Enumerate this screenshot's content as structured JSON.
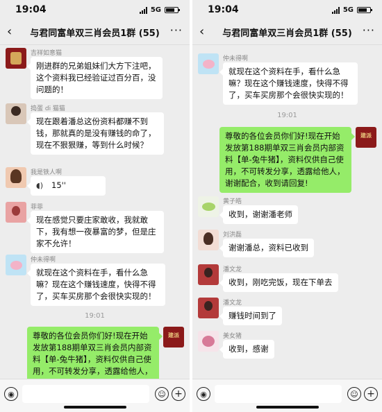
{
  "status": {
    "time": "19:04",
    "network": "5G"
  },
  "chat": {
    "title": "与君同富单双三肖会员1群 (55)"
  },
  "left": {
    "messages": [
      {
        "sender": "吉祥如意猫",
        "text": "刚进群的兄弟姐妹们大方下注吧，这个资料我已经验证过百分百，没问题的！"
      },
      {
        "sender": "捣蛋 di 猫猫",
        "text": "现在跟着潘总这份资料都赚不到钱，那就真的是没有赚钱的命了，现在不狠狠赚，等到什么时候？"
      },
      {
        "sender": "我是铁人啊",
        "voice_duration": "15''"
      },
      {
        "sender": "菲菲",
        "text": "现在感觉只要庄家敢收，我就敢下，我有想一夜暴富的梦，但是庄家不允许！"
      },
      {
        "sender": "仲未得啊",
        "text": "就现在这个资料在手，看什么急嘛？现在这个赚钱速度，快得不得了，买车买房那个会很快实现的！"
      }
    ],
    "timestamp": "19:01",
    "outgoing": "尊敬的各位会员你们好!现在开始发放第188期单双三肖会员内部资料【单-兔牛猪】，资料仅供自己使用，不可转发分享，透露给他人，谢谢配合，收到请回复!"
  },
  "right": {
    "top_message": {
      "sender": "仲未得啊",
      "text": "就现在这个资料在手，看什么急嘛？现在这个赚钱速度，快得不得了，买车买房那个会很快实现的！"
    },
    "timestamp": "19:01",
    "outgoing": "尊敬的各位会员你们好!现在开始发放第188期单双三肖会员内部资料【单-兔牛猪】，资料仅供自己使用，不可转发分享，透露给他人，谢谢配合，收到请回复!",
    "replies": [
      {
        "sender": "黄子皓",
        "text": "收到，谢谢潘老师"
      },
      {
        "sender": "刘洪磊",
        "text": "谢谢潘总，资料已收到"
      },
      {
        "sender": "潘文龙",
        "text": "收到，刚吃完饭，现在下单去"
      },
      {
        "sender": "潘文龙",
        "text": "赚钱时间到了"
      },
      {
        "sender": "美女猪",
        "text": "收到，感谢"
      }
    ]
  },
  "icons": {
    "back": "back-chevron-icon",
    "more": "more-dots-icon",
    "voice_input": "voice-input-icon",
    "emoji": "emoji-icon",
    "plus": "plus-icon"
  },
  "colors": {
    "background": "#ededed",
    "outgoing_bubble": "#95ec69",
    "incoming_bubble": "#ffffff"
  }
}
